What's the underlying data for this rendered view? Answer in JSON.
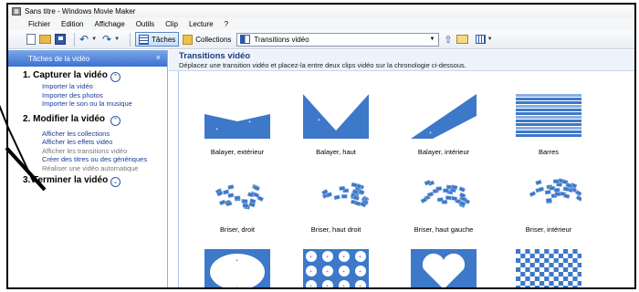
{
  "window": {
    "title": "Sans titre - Windows Movie Maker"
  },
  "menu": [
    "Fichier",
    "Edition",
    "Affichage",
    "Outils",
    "Clip",
    "Lecture",
    "?"
  ],
  "toolbar": {
    "taches_label": "Tâches",
    "collections_label": "Collections",
    "combo_value": "Transitions vidéo"
  },
  "tasks": {
    "header": "Tâches de la vidéo",
    "close": "×",
    "sections": [
      {
        "title": "1. Capturer la vidéo",
        "toggle": "⌃",
        "links": [
          "Importer la vidéo",
          "Importer des photos",
          "Importer le son ou la musique"
        ]
      },
      {
        "title": "2. Modifier la vidéo",
        "toggle": "⌃",
        "links": [
          "Afficher les collections",
          "Afficher les effets vidéo",
          "Afficher les transitions vidéo",
          "Créer des titres ou des génériques",
          "Réaliser une vidéo automatique"
        ]
      },
      {
        "title": "3. Terminer la vidéo",
        "toggle": "⌄",
        "links": []
      }
    ]
  },
  "content": {
    "title": "Transitions vidéo",
    "description": "Déplacez une transition vidéo et placez-la entre deux clips vidéo sur la chronologie ci-dessous.",
    "transitions": [
      "Balayer, extérieur",
      "Balayer, haut",
      "Balayer, intérieur",
      "Barres",
      "Briser, droit",
      "Briser, haut droit",
      "Briser, haut gauche",
      "Briser, intérieur",
      "",
      "",
      "",
      ""
    ]
  },
  "colors": {
    "accent": "#3d78c9",
    "panel_header": "#3b72d2",
    "link": "#1a3b9a"
  }
}
